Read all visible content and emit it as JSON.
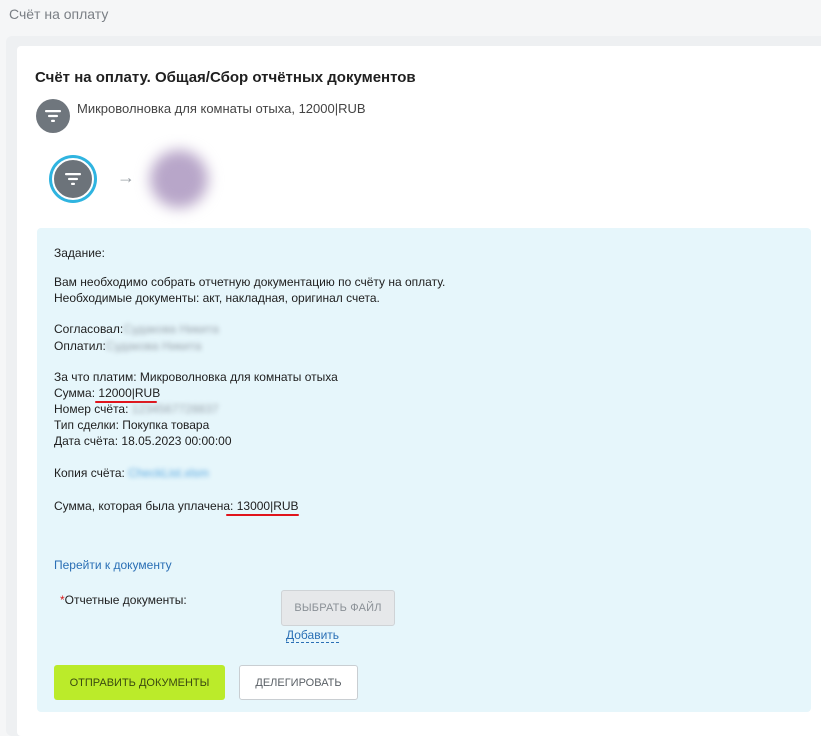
{
  "page": {
    "title": "Счёт на оплату"
  },
  "card": {
    "title": "Счёт на оплату. Общая/Сбор отчётных документов",
    "description": "Микроволновка для комнаты отыха, 12000|RUB"
  },
  "icons": {
    "process": "filter-icon",
    "step": "filter-icon",
    "arrow": "arrow-right-icon",
    "avatar": "user-avatar"
  },
  "task": {
    "heading": "Задание:",
    "line1": "Вам необходимо собрать отчетную документацию по счёту на оплату.",
    "line2": "Необходимые документы: акт, накладная, оригинал счета.",
    "approved_label": "Согласовал:",
    "approved_value": "Судакова Никита",
    "paid_label": "Оплатил:",
    "paid_value": "Судакова Никита",
    "purpose_label": "За что платим:",
    "purpose_value": "Микроволновка для комнаты отыха",
    "amount_label": "Сумма:",
    "amount_value": "12000|RUB",
    "number_label": "Номер счёта:",
    "number_value": "1234567728837",
    "deal_label": "Тип сделки:",
    "deal_value": "Покупка товара",
    "date_label": "Дата счёта:",
    "date_value": "18.05.2023 00:00:00",
    "copy_label": "Копия счёта:",
    "copy_value": "CheckList.xlsm",
    "paid_amount_label": "Сумма, которая была уплачена:",
    "paid_amount_value": "13000|RUB"
  },
  "actions": {
    "go_to_document": "Перейти к документу",
    "required_star": "*",
    "reports_label": "Отчетные документы:",
    "choose_file": "ВЫБРАТЬ ФАЙЛ",
    "add": "Добавить",
    "send": "ОТПРАВИТЬ ДОКУМЕНТЫ",
    "delegate": "ДЕЛЕГИРОВАТЬ"
  },
  "colors": {
    "accent_green": "#bbeb2a",
    "panel_bg": "#e6f6fb",
    "link": "#2a6fb5",
    "underline_red": "#e0141b",
    "step_ring": "#2fb4e0"
  }
}
